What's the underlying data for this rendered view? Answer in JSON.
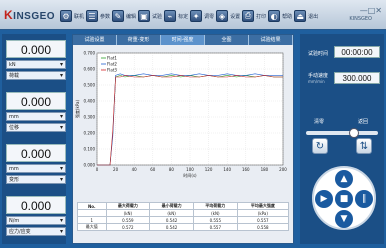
{
  "app": {
    "logo_prefix": "K",
    "logo_text": "INSGEO",
    "brand": "KINSGEO",
    "window_controls": "—□✕"
  },
  "toolbar": [
    {
      "icon": "⚙",
      "label": "联机"
    },
    {
      "icon": "☰",
      "label": "参数"
    },
    {
      "icon": "✎",
      "label": "编辑"
    },
    {
      "icon": "▣",
      "label": "试验"
    },
    {
      "icon": "⌁",
      "label": "标定"
    },
    {
      "icon": "✦",
      "label": "调零"
    },
    {
      "icon": "◈",
      "label": "设置"
    },
    {
      "icon": "⎙",
      "label": "打印"
    },
    {
      "icon": "◐",
      "label": "帮助"
    },
    {
      "icon": "⏏",
      "label": "退出"
    }
  ],
  "left": [
    {
      "value": "0.000",
      "sel": "kN",
      "sel2": "荷载"
    },
    {
      "value": "0.000",
      "sel": "mm",
      "sel2": "位移"
    },
    {
      "value": "0.000",
      "sel": "mm",
      "sel2": "变形"
    },
    {
      "value": "0.000",
      "sel": "N/m",
      "sel2": "应力/应变"
    }
  ],
  "tabs": [
    "试验设置",
    "荷重-变形",
    "时间-强度",
    "全图",
    "试验结果"
  ],
  "active_tab": 2,
  "table": {
    "headers": [
      "No.",
      "最大荷载力",
      "最小荷载力",
      "平均荷载力",
      "平均最大强度"
    ],
    "units": [
      "",
      "(kN)",
      "(kN)",
      "(kN)",
      "(kPa)"
    ],
    "rows": [
      [
        "1",
        "0.559",
        "0.542",
        "0.555",
        "0.557"
      ],
      [
        "最大值",
        "0.572",
        "0.542",
        "0.557",
        "0.558"
      ]
    ]
  },
  "right": {
    "time_label": "试验时间",
    "time_value": "00:00:00",
    "speed_label": "手动速度",
    "speed_unit": "mm/min",
    "speed_value": "300.000",
    "clear_label": "清零",
    "return_label": "返回",
    "clear_icon": "↻",
    "return_icon": "⇅",
    "up": "▲",
    "down": "▼",
    "left_arrow": "◀",
    "right_arrow": "▶",
    "stop": "■",
    "pause": "∥"
  },
  "speed_slider": 0.7,
  "chart_data": {
    "type": "line",
    "xlabel": "时间(s)",
    "ylabel": "强度(kPa)",
    "xlim": [
      0,
      200
    ],
    "ylim": [
      0,
      0.7
    ],
    "xticks": [
      0,
      20,
      40,
      60,
      80,
      100,
      120,
      140,
      160,
      180,
      200
    ],
    "yticks": [
      0,
      0.1,
      0.2,
      0.3,
      0.4,
      0.5,
      0.6,
      0.7
    ],
    "series": [
      {
        "name": "Flat1",
        "color": "#2ca02c",
        "x": [
          0,
          14,
          17,
          20,
          25,
          30,
          40,
          50,
          60,
          70,
          80,
          90,
          100,
          110,
          120,
          130,
          140,
          150,
          160,
          170,
          180,
          190,
          200
        ],
        "y": [
          0,
          0,
          0.2,
          0.55,
          0.56,
          0.55,
          0.56,
          0.55,
          0.56,
          0.55,
          0.56,
          0.55,
          0.56,
          0.55,
          0.56,
          0.55,
          0.56,
          0.55,
          0.56,
          0.55,
          0.56,
          0.55,
          0.55
        ]
      },
      {
        "name": "Flat2",
        "color": "#1f5fd0",
        "x": [
          0,
          14,
          17,
          20,
          25,
          30,
          40,
          50,
          60,
          70,
          80,
          90,
          100,
          110,
          120,
          130,
          140,
          150,
          160,
          170,
          180,
          190,
          200
        ],
        "y": [
          0,
          0,
          0.18,
          0.56,
          0.57,
          0.56,
          0.56,
          0.57,
          0.56,
          0.56,
          0.57,
          0.56,
          0.56,
          0.57,
          0.56,
          0.56,
          0.57,
          0.56,
          0.56,
          0.57,
          0.56,
          0.56,
          0.56
        ]
      },
      {
        "name": "Flat3",
        "color": "#d62728",
        "x": [
          0,
          14,
          17,
          20,
          25,
          30,
          40,
          50,
          60,
          70,
          80,
          90,
          100,
          110,
          120,
          130,
          140,
          150,
          160,
          170,
          180,
          190,
          200
        ],
        "y": [
          0,
          0,
          0.22,
          0.55,
          0.55,
          0.56,
          0.55,
          0.55,
          0.56,
          0.55,
          0.55,
          0.56,
          0.55,
          0.55,
          0.56,
          0.55,
          0.55,
          0.56,
          0.55,
          0.55,
          0.56,
          0.55,
          0.55
        ]
      }
    ]
  }
}
